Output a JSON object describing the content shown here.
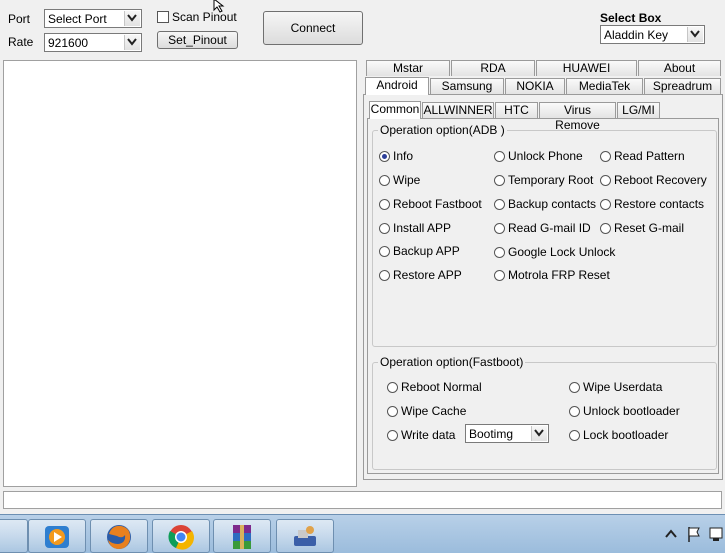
{
  "left_panel": {
    "port_label": "Port",
    "port_value": "Select Port",
    "rate_label": "Rate",
    "rate_value": "921600",
    "scan_pinout_label": "Scan Pinout",
    "set_pinout_label": "Set_Pinout",
    "connect_label": "Connect"
  },
  "select_box": {
    "label": "Select Box",
    "value": "Aladdin Key"
  },
  "tabs_row1": [
    "Mstar",
    "RDA",
    "HUAWEI",
    "About"
  ],
  "tabs_row2": [
    "Android",
    "Samsung",
    "NOKIA",
    "MediaTek",
    "Spreadrum"
  ],
  "subtabs": [
    "Common",
    "ALLWINNER",
    "HTC",
    "Virus Remove",
    "LG/MI"
  ],
  "adb_group": {
    "title": "Operation option(ADB )",
    "col1": [
      "Info",
      "Wipe",
      "Reboot Fastboot",
      "Install APP",
      "Backup APP",
      "Restore APP"
    ],
    "col2": [
      "Unlock Phone",
      "Temporary Root",
      "Backup contacts",
      "Read G-mail ID",
      "Google Lock Unlock",
      "Motrola FRP Reset"
    ],
    "col3": [
      "Read Pattern",
      "Reboot Recovery",
      "Restore contacts",
      "Reset G-mail"
    ],
    "selected": "Info"
  },
  "fastboot_group": {
    "title": "Operation option(Fastboot)",
    "col1": [
      "Reboot Normal",
      "Wipe Cache",
      "Write data"
    ],
    "col2": [
      "Wipe Userdata",
      "Unlock bootloader",
      "Lock bootloader"
    ],
    "write_data_combo": "Bootimg"
  },
  "taskbar": {
    "apps": [
      "media-player-icon",
      "firefox-icon",
      "chrome-icon",
      "winrar-icon",
      "usb-tool-icon"
    ]
  }
}
